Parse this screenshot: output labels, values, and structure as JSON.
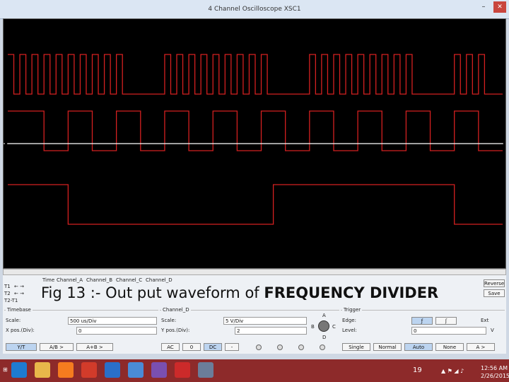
{
  "window": {
    "title": "4 Channel Oscilloscope XSC1",
    "close_label": "✕"
  },
  "scope": {
    "background": "#000000",
    "trace_color": "#d42020",
    "grid_color": "#ffffff",
    "traces": [
      {
        "name": "row1",
        "levels": [
          1,
          0,
          1,
          0,
          1,
          0,
          1,
          0,
          1,
          0,
          1,
          0,
          1,
          0,
          1,
          0,
          1,
          0,
          1,
          0,
          0,
          0,
          0,
          0,
          0,
          0,
          1,
          0,
          1,
          0,
          1,
          0,
          1,
          0,
          1,
          0,
          1,
          0,
          1,
          0,
          1,
          0,
          1,
          0,
          0,
          0,
          0,
          0,
          0,
          0,
          1,
          0,
          1,
          0,
          1,
          0,
          1,
          0,
          1,
          0,
          1,
          0,
          1,
          0,
          1,
          0,
          1,
          0,
          0,
          0,
          0,
          0,
          0,
          0,
          1,
          0,
          1,
          0,
          1,
          0,
          0,
          0
        ]
      },
      {
        "name": "row2",
        "levels": [
          1,
          1,
          1,
          1,
          1,
          1,
          0,
          0,
          0,
          0,
          1,
          1,
          1,
          1,
          0,
          0,
          0,
          0,
          1,
          1,
          1,
          1,
          0,
          0,
          0,
          0,
          1,
          1,
          1,
          1,
          0,
          0,
          0,
          0,
          1,
          1,
          1,
          1,
          0,
          0,
          0,
          0,
          1,
          1,
          1,
          1,
          0,
          0,
          0,
          0,
          1,
          1,
          1,
          1,
          0,
          0,
          0,
          0,
          1,
          1,
          1,
          1,
          0,
          0,
          0,
          0,
          1,
          1,
          1,
          1,
          0,
          0,
          0,
          0,
          1,
          1,
          1,
          1,
          0,
          0,
          0,
          0
        ]
      },
      {
        "name": "row3",
        "levels": [
          1,
          1,
          1,
          1,
          1,
          1,
          1,
          1,
          1,
          1,
          1,
          1,
          1,
          1,
          1,
          1,
          1,
          1,
          1,
          1,
          1,
          1,
          1,
          1,
          1,
          1,
          1,
          1,
          1,
          1,
          1,
          1,
          1,
          1,
          1,
          1,
          1,
          1,
          1,
          1,
          1,
          1,
          1,
          1,
          1,
          1,
          1,
          1,
          1,
          1,
          1,
          1,
          1,
          1,
          1,
          1,
          1,
          1,
          1,
          1,
          1,
          1,
          1,
          1,
          1,
          1,
          1,
          1,
          1,
          1,
          1,
          1,
          1,
          1,
          1,
          1,
          1,
          1,
          1,
          1,
          1,
          1
        ]
      },
      {
        "name": "row4",
        "levels": [
          1,
          1,
          1,
          1,
          1,
          1,
          1,
          1,
          1,
          1,
          0,
          0,
          0,
          0,
          0,
          0,
          0,
          0,
          0,
          0,
          0,
          0,
          0,
          0,
          0,
          0,
          0,
          0,
          0,
          0,
          0,
          0,
          0,
          0,
          0,
          0,
          0,
          0,
          0,
          0,
          0,
          0,
          0,
          0,
          1,
          1,
          1,
          1,
          1,
          1,
          1,
          1,
          1,
          1,
          1,
          1,
          1,
          1,
          1,
          1,
          1,
          1,
          1,
          1,
          1,
          1,
          1,
          1,
          1,
          1,
          1,
          1,
          1,
          1,
          0,
          0,
          0,
          0,
          0,
          0,
          0,
          0
        ]
      }
    ]
  },
  "panel": {
    "cursor_labels": [
      "T1",
      "T2",
      "T2-T1"
    ],
    "cursor_arrows": "← →",
    "col_headers": [
      "Time",
      "Channel_A",
      "Channel_B",
      "Channel_C",
      "Channel_D"
    ],
    "timebase": {
      "group": "Timebase",
      "scale_label": "Scale:",
      "scale_value": "500 us/Div",
      "xpos_label": "X pos.(Div):",
      "xpos_value": "0",
      "buttons": [
        "Y/T",
        "A/B >",
        "A+B >"
      ]
    },
    "channel": {
      "group": "Channel_D",
      "scale_label": "Scale:",
      "scale_value": "5 V/Div",
      "ypos_label": "Y pos.(Div):",
      "ypos_value": "2",
      "buttons": [
        "AC",
        "0",
        "DC",
        "-"
      ],
      "knob_labels": [
        "A",
        "B",
        "C",
        "D"
      ]
    },
    "trigger": {
      "group": "Trigger",
      "edge_label": "Edge:",
      "level_label": "Level:",
      "level_value": "0",
      "ext_label": "Ext",
      "unit": "V",
      "buttons": [
        "Single",
        "Normal",
        "Auto",
        "None",
        "A >"
      ],
      "selected": "Auto"
    },
    "right_buttons": [
      "Reverse",
      "Save"
    ],
    "caption_prefix": "Fig  13 :- Out put waveform of ",
    "caption_bold": "FREQUENCY DIVIDER"
  },
  "taskbar": {
    "page_number": "19",
    "time": "12:56 AM",
    "date": "2/26/2015",
    "app_colors": [
      "#1e7bd0",
      "#e8b84a",
      "#f57c1f",
      "#d23b2a",
      "#2a6fc9",
      "#4a8bd6",
      "#7a4fb0",
      "#cc2a2a",
      "#6b7d99"
    ],
    "icons": [
      "ie-icon",
      "file-explorer-icon",
      "firefox-icon",
      "media-icon",
      "video-icon",
      "settings-icon",
      "edge-icon",
      "pdf-icon",
      "app-icon"
    ]
  }
}
